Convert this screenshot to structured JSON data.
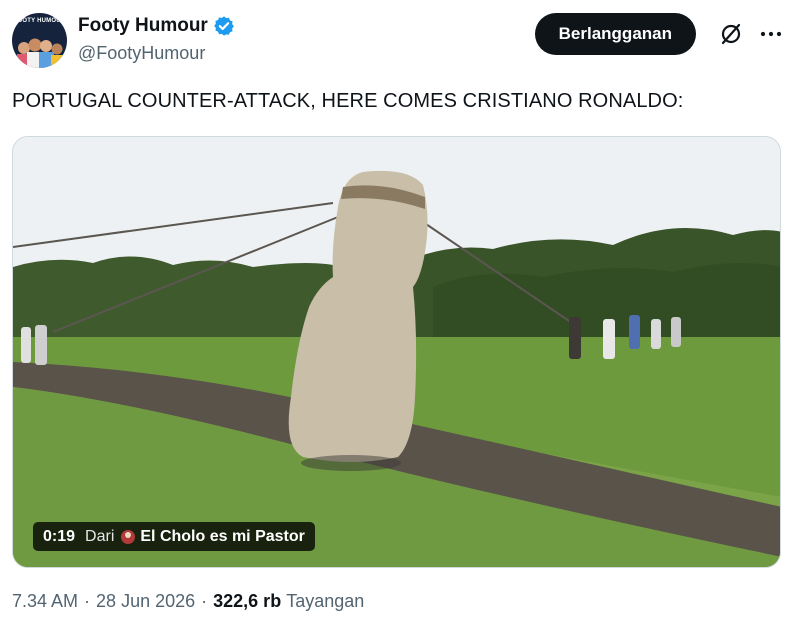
{
  "account": {
    "display_name": "Footy Humour",
    "handle": "@FootyHumour",
    "avatar_text": "FOOTY HUMOUR",
    "verified": true
  },
  "actions": {
    "subscribe_label": "Berlangganan",
    "grok_icon": "grok-icon",
    "more_icon": "more-icon"
  },
  "tweet": {
    "text": "PORTUGAL COUNTER-ATTACK, HERE COMES CRISTIANO RONALDO:"
  },
  "video": {
    "timestamp": "0:19",
    "from_label": "Dari",
    "source_name": "El Cholo es mi Pastor"
  },
  "meta": {
    "time": "7.34 AM",
    "date": "28 Jun 2026",
    "views_count": "322,6 rb",
    "views_label": "Tayangan"
  },
  "colors": {
    "verified": "#1d9bf0",
    "button_bg": "#0f1419",
    "secondary_text": "#536471"
  }
}
